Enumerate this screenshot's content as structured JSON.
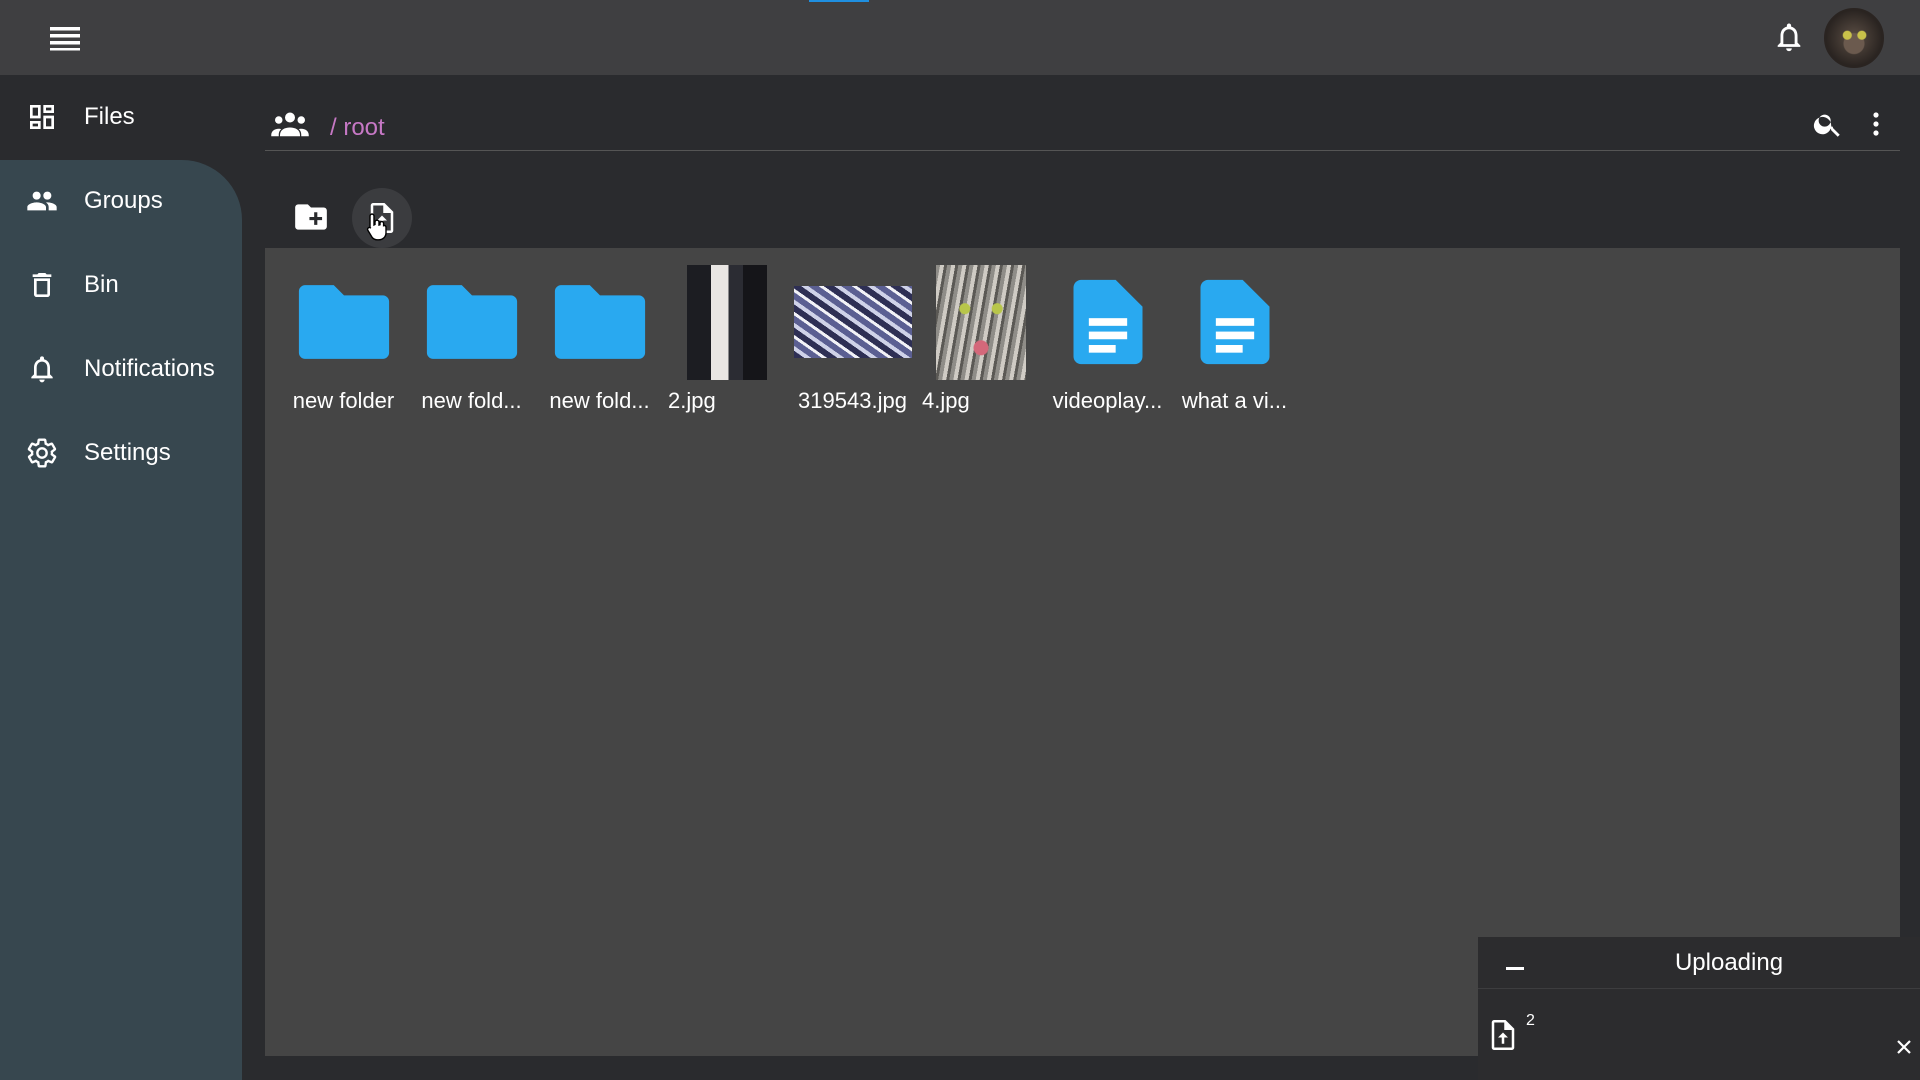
{
  "header": {
    "menu_icon": "hamburger-menu-icon",
    "notification_icon": "bell-icon",
    "avatar_alt": "user-avatar"
  },
  "sidebar": {
    "items": [
      {
        "label": "Files",
        "icon": "dashboard-icon"
      },
      {
        "label": "Groups",
        "icon": "people-icon"
      },
      {
        "label": "Bin",
        "icon": "trash-icon"
      },
      {
        "label": "Notifications",
        "icon": "bell-icon"
      },
      {
        "label": "Settings",
        "icon": "gear-icon"
      }
    ]
  },
  "main": {
    "breadcrumb": "/ root",
    "toolbar": {
      "new_folder_icon": "create-new-folder-icon",
      "upload_file_icon": "upload-file-icon"
    },
    "files": [
      {
        "name": "new folder",
        "type": "folder"
      },
      {
        "name": "new fold...",
        "type": "folder"
      },
      {
        "name": "new fold...",
        "type": "folder"
      },
      {
        "name": "2.jpg",
        "type": "image"
      },
      {
        "name": "319543.jpg",
        "type": "image"
      },
      {
        "name": "4.jpg",
        "type": "image"
      },
      {
        "name": "videoplay...",
        "type": "document"
      },
      {
        "name": "what a vi...",
        "type": "document"
      }
    ]
  },
  "upload": {
    "title": "Uploading",
    "count": "2"
  },
  "colors": {
    "accent": "#2196f3",
    "folder": "#29a9f0",
    "breadcrumb": "#c678c5",
    "sidebar_active_bg": "#37474f"
  }
}
